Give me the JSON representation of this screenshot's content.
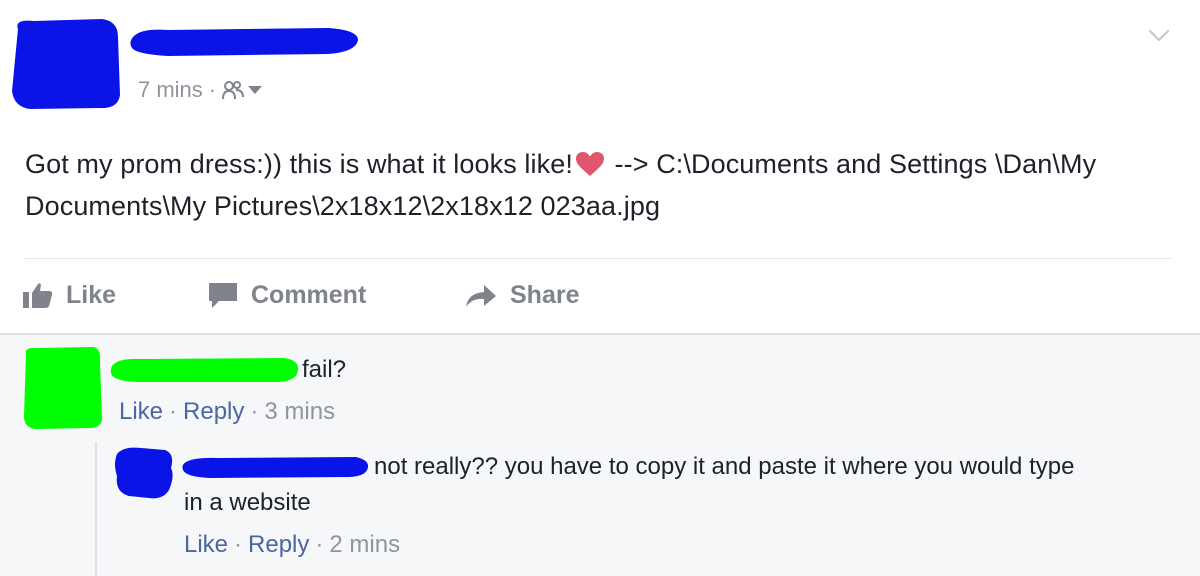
{
  "post": {
    "time": "7 mins",
    "meta_separator": "·",
    "text": "Got my prom dress:)) this is what it looks like!",
    "path_text": " --> C:\\Documents and Settings \\Dan\\My Documents\\My Pictures\\2x18x12\\2x18x12 023aa.jpg",
    "icons": {
      "audience": "friends-audience-icon",
      "audience_menu": "chevron-down-icon",
      "options": "post-options-chevron-icon",
      "emoji": "heart-icon"
    }
  },
  "actions": {
    "like": "Like",
    "comment": "Comment",
    "share": "Share"
  },
  "comments": [
    {
      "text": "fail?",
      "like": "Like",
      "reply": "Reply",
      "separator": "·",
      "time": "3 mins",
      "redaction_color": "#00ff00"
    },
    {
      "text": "not really?? you have to copy it and paste it where you would type in a website",
      "like": "Like",
      "reply": "Reply",
      "separator": "·",
      "time": "2 mins",
      "redaction_color": "#0a14e6"
    }
  ],
  "colors": {
    "author_redaction": "#0a14e6",
    "link": "#4b67a1",
    "meta": "#90949c",
    "heart": "#e0576d"
  }
}
